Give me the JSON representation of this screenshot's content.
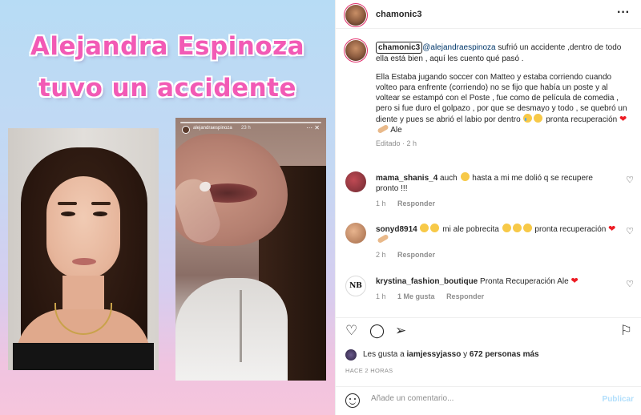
{
  "media": {
    "title_line1": "Alejandra Espinoza",
    "title_line2": "tuvo un accidente",
    "story": {
      "username": "alejandraespinoza",
      "time": "23 h"
    }
  },
  "header": {
    "username": "chamonic3",
    "more_icon": "more-horizontal-icon"
  },
  "caption": {
    "username": "chamonic3",
    "mention": "@alejandraespinoza",
    "text1": " sufrió un accidente ,dentro de todo ella está bien , aquí les cuento qué pasó .",
    "text2": "Ella Estaba jugando soccer con Matteo y estaba corriendo cuando volteo para enfrente (corriendo) no se fijo que había un poste y al voltear se estampó con el Poste , fue como de película de comedia , pero si fue duro el golpazo , por que se desmayo y todo , se quebró un diente y pues se abrió el labio por dentro",
    "text3": " pronta recuperación ",
    "text4": " Ale",
    "edited": "Editado",
    "time": "2 h"
  },
  "comments": [
    {
      "username": "mama_shanis_4",
      "text_before": " auch ",
      "text_after": " hasta a mi me dolió q se recupere pronto !!!",
      "time": "1 h",
      "likes": "",
      "reply": "Responder"
    },
    {
      "username": "sonyd8914",
      "text_before": " ",
      "text_after": " mi ale pobrecita ",
      "text_tail": " pronta recuperación ",
      "time": "2 h",
      "likes": "",
      "reply": "Responder"
    },
    {
      "username": "krystina_fashion_boutique",
      "text_before": " Pronta Recuperación Ale ",
      "text_after": "",
      "time": "1 h",
      "likes": "1 Me gusta",
      "reply": "Responder",
      "avatar_text": "NB"
    }
  ],
  "likes": {
    "prefix": "Les gusta a ",
    "user": "iamjessyjasso",
    "middle": " y ",
    "count": "672 personas más"
  },
  "time_ago": "HACE 2 HORAS",
  "comment_box": {
    "placeholder": "Añade un comentario...",
    "publish": "Publicar"
  },
  "icons": [
    "heart-icon",
    "comment-icon",
    "share-icon",
    "bookmark-icon",
    "smiley-icon"
  ]
}
